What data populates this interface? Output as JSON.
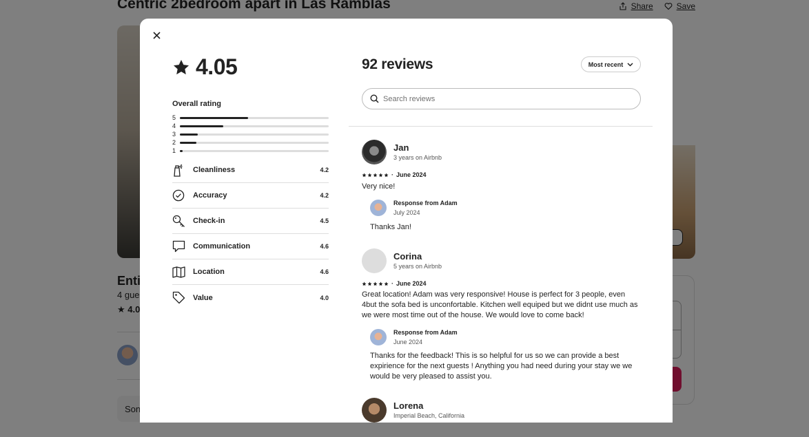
{
  "background": {
    "title": "Centric 2bedroom apart in Las Ramblas",
    "share_label": "Share",
    "save_label": "Save",
    "sub1": "Entir",
    "sub2": "4 gues",
    "sub3": "4.0",
    "some_label": "Son"
  },
  "modal": {
    "rating": "4.05",
    "overall_label": "Overall rating",
    "distribution": [
      {
        "stars": "5",
        "fraction": 0.46
      },
      {
        "stars": "4",
        "fraction": 0.29
      },
      {
        "stars": "3",
        "fraction": 0.12
      },
      {
        "stars": "2",
        "fraction": 0.11
      },
      {
        "stars": "1",
        "fraction": 0.02
      }
    ],
    "categories": [
      {
        "icon": "cleaning-spray-icon",
        "label": "Cleanliness",
        "value": "4.2"
      },
      {
        "icon": "check-circle-icon",
        "label": "Accuracy",
        "value": "4.2"
      },
      {
        "icon": "key-icon",
        "label": "Check-in",
        "value": "4.5"
      },
      {
        "icon": "chat-bubble-icon",
        "label": "Communication",
        "value": "4.6"
      },
      {
        "icon": "map-icon",
        "label": "Location",
        "value": "4.6"
      },
      {
        "icon": "tag-icon",
        "label": "Value",
        "value": "4.0"
      }
    ],
    "reviews_count": "92 reviews",
    "sort_label": "Most recent",
    "search_placeholder": "Search reviews",
    "reviews": [
      {
        "name": "Jan",
        "meta": "3 years on Airbnb",
        "date": "June 2024",
        "text": "Very nice!",
        "response": {
          "from": "Response from Adam",
          "date": "July 2024",
          "text": "Thanks Jan!"
        }
      },
      {
        "name": "Corina",
        "meta": "5 years on Airbnb",
        "date": "June 2024",
        "text": "Great location! Adam was very responsive! House is perfect for 3 people, even 4but the sofa bed is unconfortable. Kitchen well equiped but we didnt use much as we were most time out of the house. We would love to come back!",
        "response": {
          "from": "Response from Adam",
          "date": "June 2024",
          "text": "Thanks for the feedback! This is so helpful for us so we can provide a best expirience for the next guests ! Anything you had need during your stay we we would be very pleased to assist you."
        }
      },
      {
        "name": "Lorena",
        "meta": "Imperial Beach, California"
      }
    ],
    "separator": "·"
  }
}
